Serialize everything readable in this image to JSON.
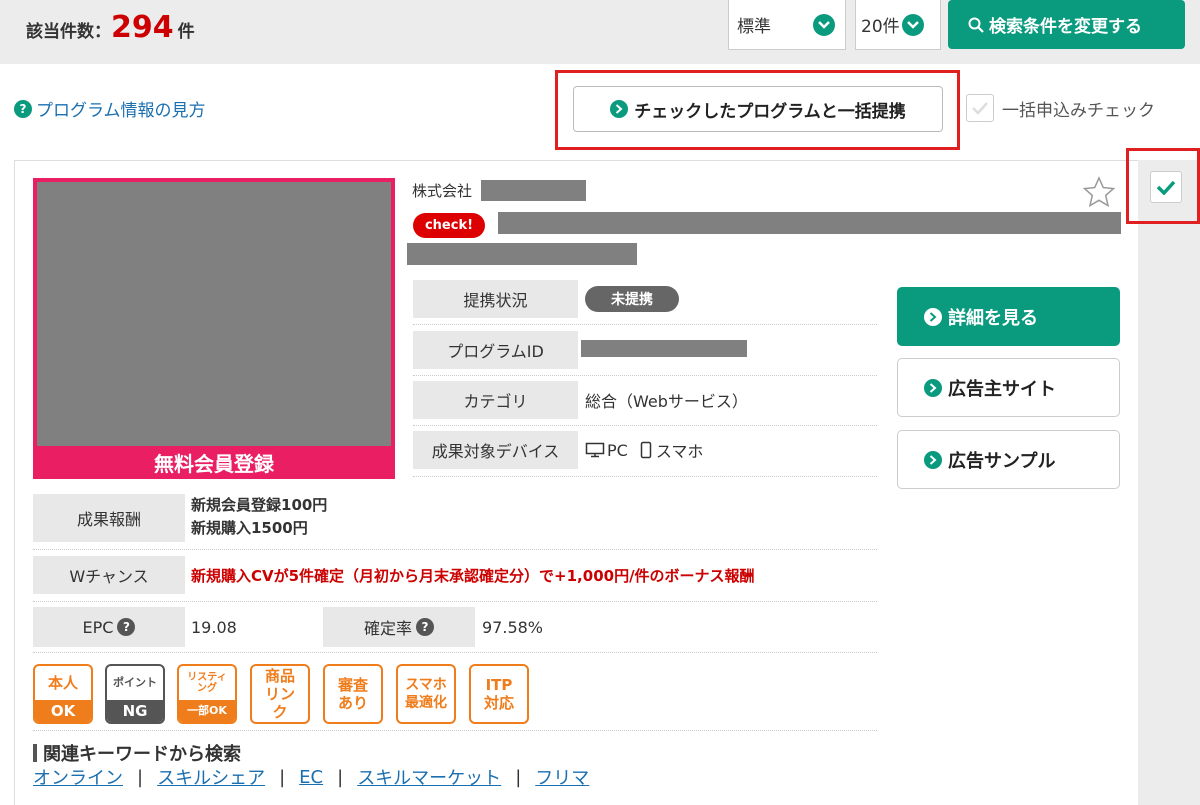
{
  "header": {
    "count_label": "該当件数：",
    "count_value": "294",
    "count_unit": "件",
    "sort_select": "標準",
    "per_page_select": "20件",
    "change_search_label": "検索条件を変更する"
  },
  "toolbar": {
    "howto_label": "プログラム情報の見方",
    "bulk_partner_label": "チェックしたプログラムと一括提携",
    "bulk_check_label": "一括申込みチェック"
  },
  "program": {
    "company_prefix": "株式会社",
    "check_badge": "check!",
    "thumb_label": "無料会員登録",
    "info_rows": [
      {
        "label": "提携状況",
        "value": "未提携"
      },
      {
        "label": "プログラムID",
        "value": ""
      },
      {
        "label": "カテゴリ",
        "value": "総合（Webサービス）"
      },
      {
        "label": "成果対象デバイス",
        "value_pc": "PC",
        "value_sp": "スマホ"
      }
    ],
    "reward_label": "成果報酬",
    "reward_lines": [
      "新規会員登録100円",
      "新規購入1500円"
    ],
    "wchance_label": "Wチャンス",
    "wchance_text": "新規購入CVが5件確定（月初から月末承認確定分）で+1,000円/件のボーナス報酬",
    "epc_label": "EPC",
    "epc_value": "19.08",
    "rate_label": "確定率",
    "rate_value": "97.58%",
    "buttons": {
      "detail": "詳細を見る",
      "advertiser_site": "広告主サイト",
      "ad_sample": "広告サンプル"
    },
    "tags": [
      {
        "top": "本人",
        "bottom": "OK"
      },
      {
        "top": "ポイント",
        "bottom": "NG"
      },
      {
        "top": "リスティング",
        "bottom": "一部OK"
      },
      {
        "text": "商品リンク"
      },
      {
        "text": "審査あり"
      },
      {
        "text": "スマホ最適化"
      },
      {
        "text": "ITP対応"
      }
    ],
    "keywords_title": "関連キーワードから検索",
    "keywords": [
      "オンライン",
      "スキルシェア",
      "EC",
      "スキルマーケット",
      "フリマ"
    ]
  },
  "colors": {
    "accent": "#0a9a7e",
    "highlight_red": "#e02020",
    "count_red": "#cc0000",
    "tag_orange": "#f07d1b",
    "thumb_pink": "#e91e63"
  }
}
